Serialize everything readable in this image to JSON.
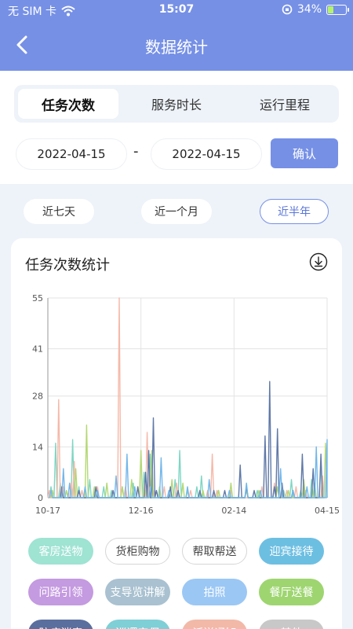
{
  "status": {
    "carrier": "无 SIM 卡",
    "time": "15:07",
    "battery": "34%",
    "battery_level": 0.34
  },
  "nav": {
    "title": "数据统计"
  },
  "tabs": [
    {
      "label": "任务次数",
      "active": true
    },
    {
      "label": "服务时长",
      "active": false
    },
    {
      "label": "运行里程",
      "active": false
    }
  ],
  "date_range": {
    "start": "2022-04-15",
    "separator": "-",
    "end": "2022-04-15",
    "confirm": "确认"
  },
  "quick_ranges": [
    {
      "label": "近七天",
      "active": false
    },
    {
      "label": "近一个月",
      "active": false
    },
    {
      "label": "近半年",
      "active": true
    }
  ],
  "card": {
    "title": "任务次数统计",
    "download_icon": "download-icon"
  },
  "chart_data": {
    "type": "line",
    "title": "",
    "x_ticks": [
      "10-17",
      "12-16",
      "02-14",
      "04-15"
    ],
    "y_ticks": [
      "0",
      "14",
      "28",
      "41",
      "55"
    ],
    "ylim": [
      0,
      55
    ],
    "x_count": 181,
    "grid": true,
    "series": [
      {
        "color": "#7ed6c3",
        "points": [
          [
            2,
            3
          ],
          [
            5,
            15
          ],
          [
            8,
            4
          ],
          [
            12,
            2
          ],
          [
            16,
            16
          ],
          [
            20,
            3
          ],
          [
            27,
            5
          ],
          [
            30,
            2
          ],
          [
            36,
            3
          ],
          [
            41,
            2
          ],
          [
            48,
            3
          ],
          [
            55,
            4
          ],
          [
            62,
            7
          ],
          [
            66,
            12
          ],
          [
            70,
            2
          ],
          [
            82,
            5
          ],
          [
            85,
            13
          ],
          [
            90,
            2
          ],
          [
            96,
            3
          ],
          [
            99,
            6
          ],
          [
            110,
            2
          ],
          [
            118,
            2
          ],
          [
            128,
            3
          ],
          [
            135,
            2
          ],
          [
            146,
            3
          ],
          [
            152,
            2
          ],
          [
            157,
            5
          ],
          [
            163,
            2
          ],
          [
            170,
            5
          ],
          [
            176,
            10
          ]
        ]
      },
      {
        "color": "#f5b8a8",
        "points": [
          [
            1,
            2
          ],
          [
            7,
            27
          ],
          [
            10,
            3
          ],
          [
            15,
            4
          ],
          [
            17,
            10
          ],
          [
            22,
            2
          ],
          [
            32,
            3
          ],
          [
            42,
            2
          ],
          [
            46,
            55
          ],
          [
            50,
            3
          ],
          [
            58,
            3
          ],
          [
            64,
            18
          ],
          [
            68,
            2
          ],
          [
            75,
            3
          ],
          [
            83,
            4
          ],
          [
            92,
            2
          ],
          [
            103,
            2
          ],
          [
            106,
            12
          ],
          [
            109,
            2
          ],
          [
            118,
            2
          ],
          [
            138,
            3
          ],
          [
            146,
            4
          ],
          [
            154,
            2
          ],
          [
            160,
            3
          ],
          [
            166,
            2
          ],
          [
            172,
            3
          ],
          [
            177,
            6
          ]
        ]
      },
      {
        "color": "#b4d874",
        "points": [
          [
            3,
            2
          ],
          [
            12,
            2
          ],
          [
            18,
            8
          ],
          [
            25,
            20
          ],
          [
            30,
            3
          ],
          [
            38,
            4
          ],
          [
            48,
            3
          ],
          [
            54,
            5
          ],
          [
            60,
            13
          ],
          [
            63,
            2
          ],
          [
            67,
            13
          ],
          [
            72,
            3
          ],
          [
            80,
            5
          ],
          [
            87,
            4
          ],
          [
            100,
            2
          ],
          [
            110,
            2
          ],
          [
            118,
            4
          ],
          [
            128,
            2
          ],
          [
            136,
            2
          ],
          [
            148,
            3
          ],
          [
            155,
            2
          ],
          [
            165,
            5
          ],
          [
            172,
            4
          ],
          [
            179,
            15
          ]
        ]
      },
      {
        "color": "#6079a8",
        "points": [
          [
            9,
            3
          ],
          [
            20,
            2
          ],
          [
            31,
            3
          ],
          [
            42,
            2
          ],
          [
            58,
            3
          ],
          [
            63,
            7
          ],
          [
            65,
            13
          ],
          [
            68,
            22
          ],
          [
            70,
            2
          ],
          [
            79,
            3
          ],
          [
            84,
            2
          ],
          [
            98,
            2
          ],
          [
            107,
            2
          ],
          [
            114,
            2
          ],
          [
            124,
            9
          ],
          [
            128,
            3
          ],
          [
            133,
            2
          ],
          [
            140,
            17
          ],
          [
            143,
            32
          ],
          [
            146,
            3
          ],
          [
            148,
            19
          ],
          [
            151,
            4
          ],
          [
            158,
            2
          ],
          [
            164,
            12
          ],
          [
            171,
            8
          ],
          [
            176,
            12
          ]
        ]
      },
      {
        "color": "#72b7ea",
        "points": [
          [
            2,
            2
          ],
          [
            10,
            8
          ],
          [
            14,
            4
          ],
          [
            24,
            3
          ],
          [
            32,
            2
          ],
          [
            44,
            6
          ],
          [
            51,
            12
          ],
          [
            56,
            3
          ],
          [
            66,
            3
          ],
          [
            73,
            11
          ],
          [
            78,
            2
          ],
          [
            90,
            3
          ],
          [
            104,
            5
          ],
          [
            117,
            2
          ],
          [
            128,
            4
          ],
          [
            137,
            2
          ],
          [
            150,
            8
          ],
          [
            158,
            2
          ],
          [
            167,
            3
          ],
          [
            173,
            14
          ],
          [
            180,
            16
          ]
        ]
      }
    ]
  },
  "chips": [
    {
      "label": "客房送物",
      "color": "#9fe3d3",
      "outline": false
    },
    {
      "label": "货柜购物",
      "color": "#ffffff",
      "outline": true
    },
    {
      "label": "帮取帮送",
      "color": "#ffffff",
      "outline": true
    },
    {
      "label": "迎宾接待",
      "color": "#6dbfe2",
      "outline": false
    },
    {
      "label": "问路引领",
      "color": "#c49ae0",
      "outline": false
    },
    {
      "label": "支导览讲解",
      "color": "#a9c1d0",
      "outline": false
    },
    {
      "label": "拍照",
      "color": "#9bc7f5",
      "outline": false
    },
    {
      "label": "餐厅送餐",
      "color": "#9ed570",
      "outline": false
    },
    {
      "label": "防疫消毒",
      "color": "#5a6f9e",
      "outline": false
    },
    {
      "label": "巡逻安保",
      "color": "#7fcfd6",
      "outline": false
    },
    {
      "label": "派送通知",
      "color": "#f2b9a8",
      "outline": false
    },
    {
      "label": "其他",
      "color": "#c8c8c8",
      "outline": false
    }
  ]
}
